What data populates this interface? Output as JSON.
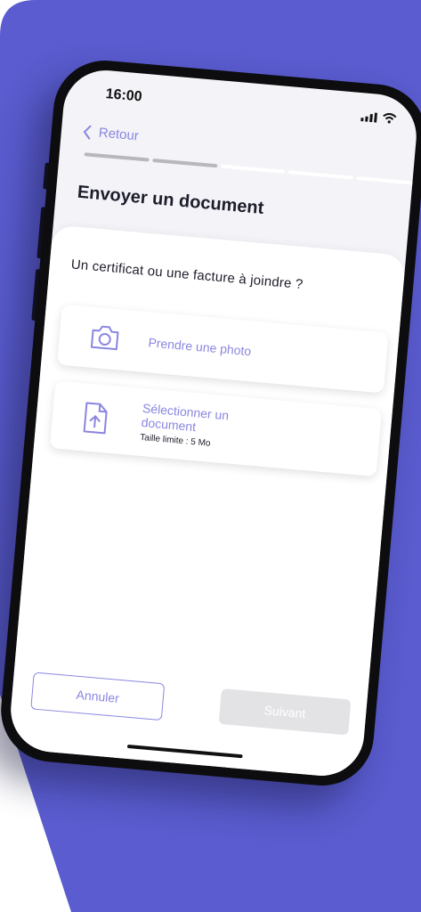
{
  "status_bar": {
    "time": "16:00"
  },
  "nav": {
    "back_label": "Retour"
  },
  "progress": {
    "total_steps": 5,
    "completed_steps": 2
  },
  "page": {
    "title": "Envoyer un document",
    "question": "Un certificat ou une facture à joindre ?"
  },
  "options": [
    {
      "label": "Prendre une photo",
      "icon": "camera-icon"
    },
    {
      "label": "Sélectionner un document",
      "hint": "Taille limite : 5 Mo",
      "icon": "file-upload-icon"
    }
  ],
  "footer": {
    "cancel_label": "Annuler",
    "next_label": "Suivant"
  },
  "colors": {
    "background": "#5a5ccf",
    "accent": "#8a86e0",
    "disabled": "#e3e3e6"
  }
}
